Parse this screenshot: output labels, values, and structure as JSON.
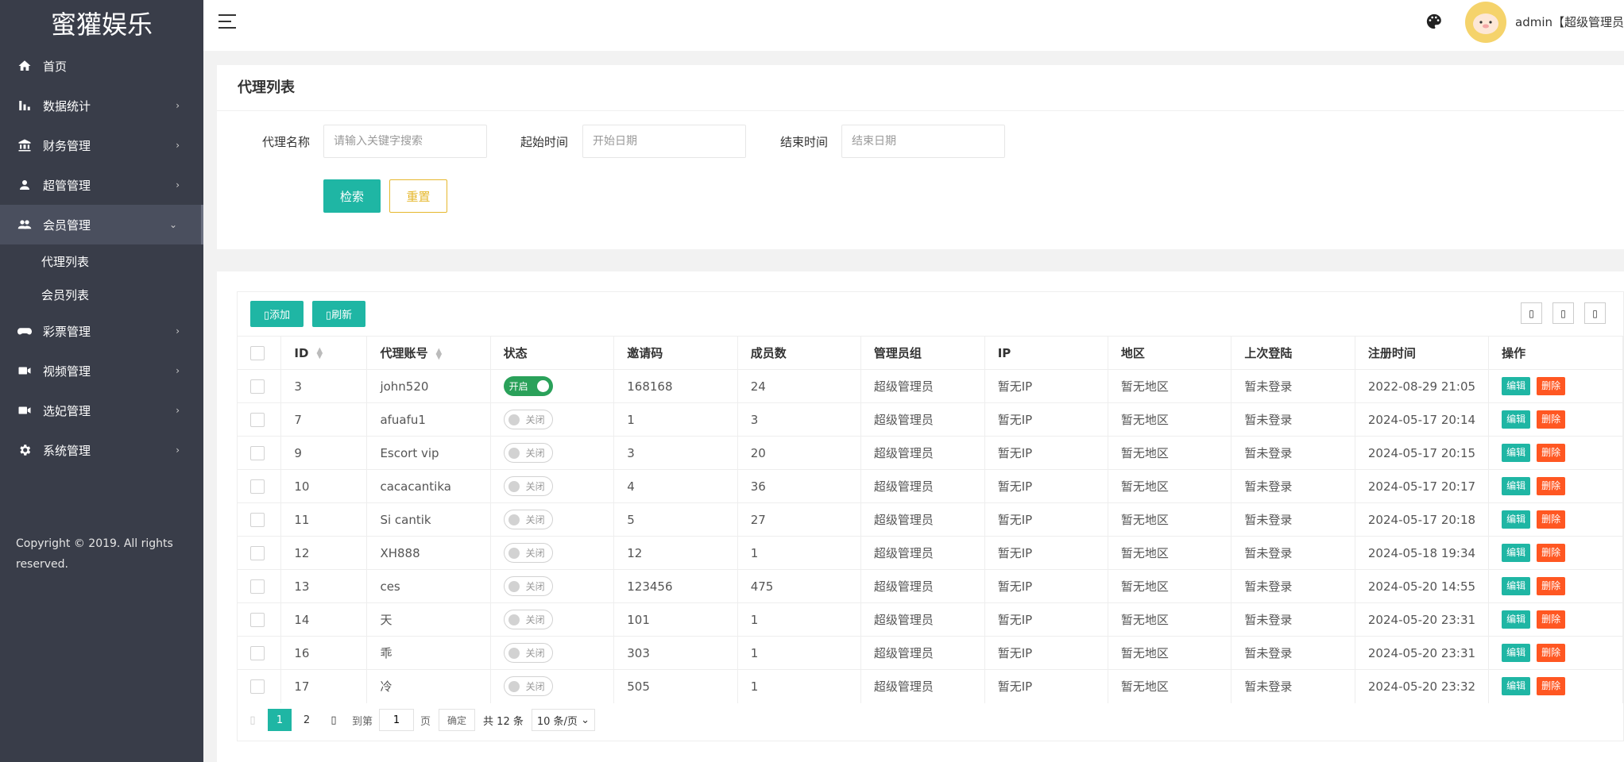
{
  "app": {
    "logo": "蜜獾娱乐"
  },
  "sidebar": {
    "items": [
      {
        "label": "首页",
        "icon": "home-icon",
        "has_arrow": false
      },
      {
        "label": "数据统计",
        "icon": "bar-chart-icon",
        "has_arrow": true
      },
      {
        "label": "财务管理",
        "icon": "bank-icon",
        "has_arrow": true
      },
      {
        "label": "超管管理",
        "icon": "user-icon",
        "has_arrow": true
      },
      {
        "label": "会员管理",
        "icon": "users-icon",
        "has_arrow": true,
        "expanded": true
      }
    ],
    "sub_items": [
      {
        "label": "代理列表"
      },
      {
        "label": "会员列表"
      }
    ],
    "items_after": [
      {
        "label": "彩票管理",
        "icon": "gamepad-icon",
        "has_arrow": true
      },
      {
        "label": "视频管理",
        "icon": "video-icon",
        "has_arrow": true
      },
      {
        "label": "选妃管理",
        "icon": "video-icon",
        "has_arrow": true
      },
      {
        "label": "系统管理",
        "icon": "gear-icon",
        "has_arrow": true
      }
    ],
    "copyright": "Copyright © 2019. All rights reserved."
  },
  "header": {
    "user": "admin【超级管理员】"
  },
  "search": {
    "title": "代理列表",
    "name_label": "代理名称",
    "name_placeholder": "请输入关键字搜索",
    "start_label": "起始时间",
    "start_placeholder": "开始日期",
    "end_label": "结束时间",
    "end_placeholder": "结束日期",
    "search_btn": "检索",
    "reset_btn": "重置"
  },
  "toolbar": {
    "add_label": "添加",
    "refresh_label": "刷新"
  },
  "table": {
    "columns": [
      "ID",
      "代理账号",
      "状态",
      "邀请码",
      "成员数",
      "管理员组",
      "IP",
      "地区",
      "上次登陆",
      "注册时间",
      "操作"
    ],
    "status_on": "开启",
    "status_off": "关闭",
    "edit_label": "编辑",
    "delete_label": "删除",
    "rows": [
      {
        "id": "3",
        "account": "john520",
        "on": true,
        "code": "168168",
        "members": "24",
        "group": "超级管理员",
        "ip": "暂无IP",
        "region": "暂无地区",
        "last_login": "暂未登录",
        "reg_time": "2022-08-29 21:05"
      },
      {
        "id": "7",
        "account": "afuafu1",
        "on": false,
        "code": "1",
        "members": "3",
        "group": "超级管理员",
        "ip": "暂无IP",
        "region": "暂无地区",
        "last_login": "暂未登录",
        "reg_time": "2024-05-17 20:14"
      },
      {
        "id": "9",
        "account": "Escort vip",
        "on": false,
        "code": "3",
        "members": "20",
        "group": "超级管理员",
        "ip": "暂无IP",
        "region": "暂无地区",
        "last_login": "暂未登录",
        "reg_time": "2024-05-17 20:15"
      },
      {
        "id": "10",
        "account": "cacacantika",
        "on": false,
        "code": "4",
        "members": "36",
        "group": "超级管理员",
        "ip": "暂无IP",
        "region": "暂无地区",
        "last_login": "暂未登录",
        "reg_time": "2024-05-17 20:17"
      },
      {
        "id": "11",
        "account": "Si cantik",
        "on": false,
        "code": "5",
        "members": "27",
        "group": "超级管理员",
        "ip": "暂无IP",
        "region": "暂无地区",
        "last_login": "暂未登录",
        "reg_time": "2024-05-17 20:18"
      },
      {
        "id": "12",
        "account": "XH888",
        "on": false,
        "code": "12",
        "members": "1",
        "group": "超级管理员",
        "ip": "暂无IP",
        "region": "暂无地区",
        "last_login": "暂未登录",
        "reg_time": "2024-05-18 19:34"
      },
      {
        "id": "13",
        "account": "ces",
        "on": false,
        "code": "123456",
        "members": "475",
        "group": "超级管理员",
        "ip": "暂无IP",
        "region": "暂无地区",
        "last_login": "暂未登录",
        "reg_time": "2024-05-20 14:55"
      },
      {
        "id": "14",
        "account": "天",
        "on": false,
        "code": "101",
        "members": "1",
        "group": "超级管理员",
        "ip": "暂无IP",
        "region": "暂无地区",
        "last_login": "暂未登录",
        "reg_time": "2024-05-20 23:31"
      },
      {
        "id": "16",
        "account": "乖",
        "on": false,
        "code": "303",
        "members": "1",
        "group": "超级管理员",
        "ip": "暂无IP",
        "region": "暂无地区",
        "last_login": "暂未登录",
        "reg_time": "2024-05-20 23:31"
      },
      {
        "id": "17",
        "account": "冷",
        "on": false,
        "code": "505",
        "members": "1",
        "group": "超级管理员",
        "ip": "暂无IP",
        "region": "暂无地区",
        "last_login": "暂未登录",
        "reg_time": "2024-05-20 23:32"
      }
    ]
  },
  "pager": {
    "pages": [
      "1",
      "2"
    ],
    "current": "1",
    "goto_prefix": "到第",
    "goto_value": "1",
    "goto_suffix": "页",
    "confirm": "确定",
    "total": "共 12 条",
    "per_page": "10 条/页"
  },
  "colors": {
    "sidebar": "#393d49",
    "accent": "#1fb6a4",
    "danger": "#ff5722",
    "switch_on": "#2aa15a",
    "reset": "#e6b82e"
  }
}
